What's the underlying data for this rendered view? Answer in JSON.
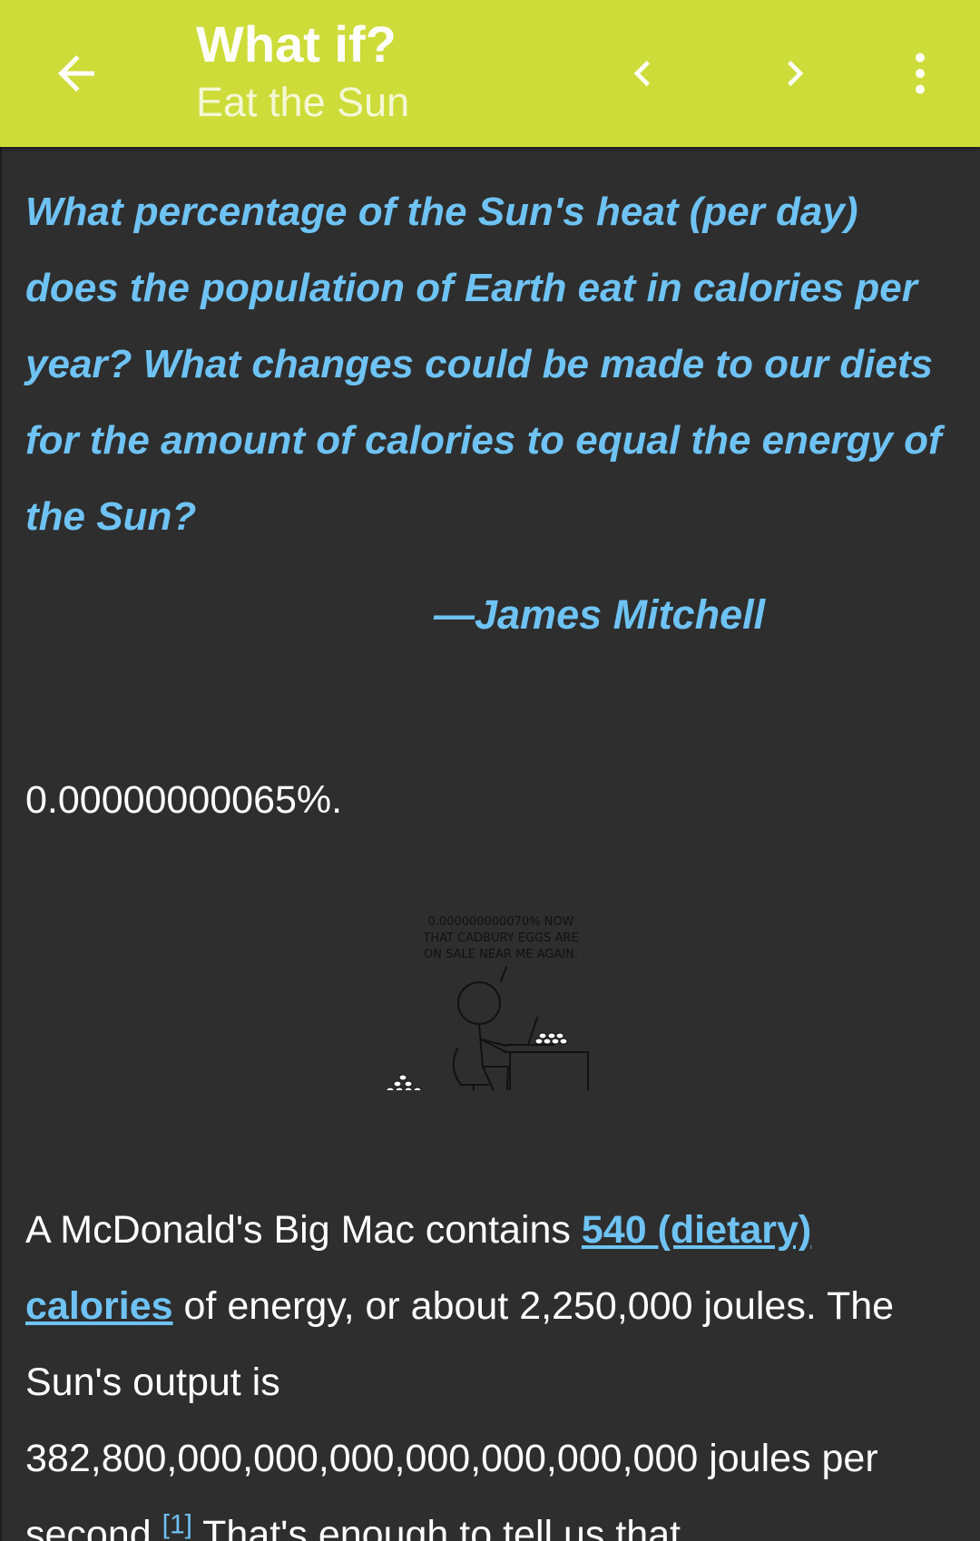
{
  "app_bar": {
    "title": "What if?",
    "subtitle": "Eat the Sun",
    "icons": {
      "back": "arrow-left-icon",
      "previous": "chevron-left-icon",
      "next": "chevron-right-icon",
      "more": "more-vertical-icon"
    },
    "color": "#cddc39"
  },
  "article": {
    "question": "What percentage of the Sun's heat (per day) does the population of Earth eat in calories per year? What changes could be made to our diets for the amount of calories to equal the energy of the Sun?",
    "attribution": "—James Mitchell",
    "answer": "0.00000000065%.",
    "comic_caption_lines": [
      "0.000000000070% NOW",
      "THAT CADBURY EGGS ARE",
      "ON SALE NEAR ME AGAIN."
    ],
    "paragraph": {
      "text_before_link": "A McDonald's Big Mac contains ",
      "link_text": "540 (dietary) calories",
      "text_after_link": " of energy, or about 2,250,000 joules. The Sun's output is 382,800,000,000,000,000,000,000,000 joules per second.",
      "footnote": "[1]",
      "text_after_footnote": " That's enough to tell us that"
    },
    "text_color": "#ffffff",
    "accent_color": "#6ec3f4",
    "background_color": "#2e2e2e"
  }
}
